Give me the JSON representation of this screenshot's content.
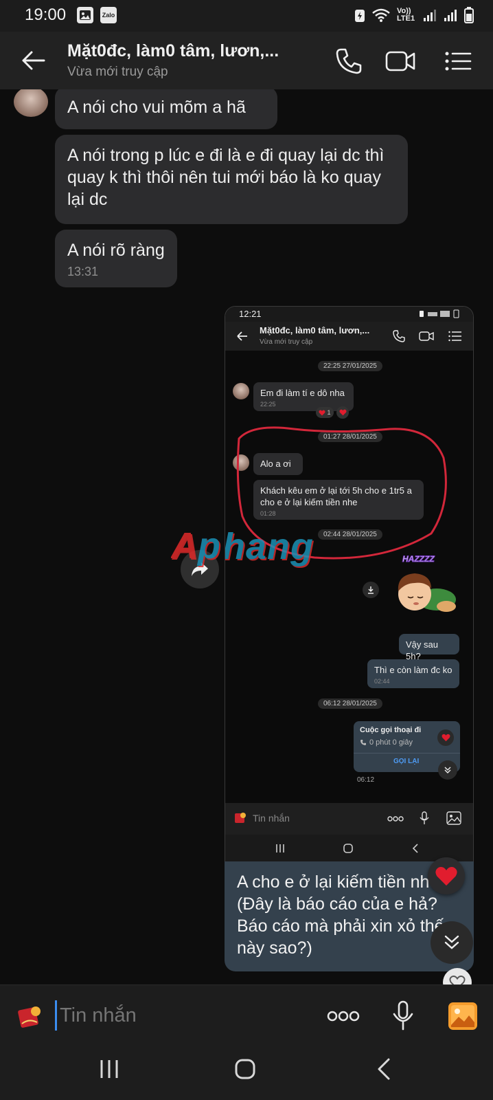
{
  "status_bar": {
    "time": "19:00",
    "zalo_badge": "Zalo",
    "network_label": "Vo)) LTE1"
  },
  "header": {
    "title": "Mặt0đc, làm0 tâm, lươn,...",
    "subtitle": "Vừa mới truy cập"
  },
  "messages": [
    {
      "text": "A nói cho vui mõm a hã"
    },
    {
      "text": "A nói trong p lúc e đi là e đi quay lại dc thì quay k thì thôi nên tui mới báo là ko quay lại dc"
    },
    {
      "text": "A nói rõ ràng",
      "time": "13:31"
    }
  ],
  "screenshot": {
    "status_time": "12:21",
    "title": "Mặt0đc, làm0 tâm, lươn,...",
    "subtitle": "Vừa mới truy cập",
    "chips": [
      "22:25 27/01/2025",
      "01:27 28/01/2025",
      "02:44 28/01/2025",
      "06:12 28/01/2025"
    ],
    "msg1": {
      "text": "Em đi làm tí e dô nha",
      "time": "22:25",
      "reaction_count": "1"
    },
    "msg2": {
      "text": "Alo a ơi"
    },
    "msg3": {
      "text": "Khách kêu em ở lại tới 5h cho e 1tr5 a cho e ở lại kiếm tiền nhe",
      "time": "01:28"
    },
    "sticker_text": "HAZZZZ",
    "msg4": {
      "text": "Vậy sau 5h?"
    },
    "msg5": {
      "text": "Thì e còn làm đc ko",
      "time": "02:44"
    },
    "call": {
      "title": "Cuộc gọi thoại đi",
      "duration": "0 phút 0 giây",
      "action": "GỌI LẠI",
      "time": "06:12"
    },
    "input_placeholder": "Tin nhắn",
    "watermark": "Aphang"
  },
  "caption": {
    "text": "A cho e ở lại kiếm tiền nhe (Đây là báo cáo của e hả? Báo cáo mà phải xin xỏ thế này sao?)"
  },
  "input": {
    "placeholder": "Tin nhắn"
  },
  "colors": {
    "accent_blue": "#3b8df0",
    "bubble_other": "#2c2c2e",
    "bubble_me": "#34414d",
    "heart_red": "#e11d2e",
    "annotation_red": "#d2273a"
  },
  "icons": [
    "back-arrow-icon",
    "phone-icon",
    "video-call-icon",
    "menu-list-icon",
    "forward-icon",
    "heart-icon",
    "scroll-down-icon",
    "sticker-icon",
    "more-icon",
    "mic-icon",
    "gallery-icon",
    "recents-icon",
    "home-icon",
    "nav-back-icon"
  ]
}
